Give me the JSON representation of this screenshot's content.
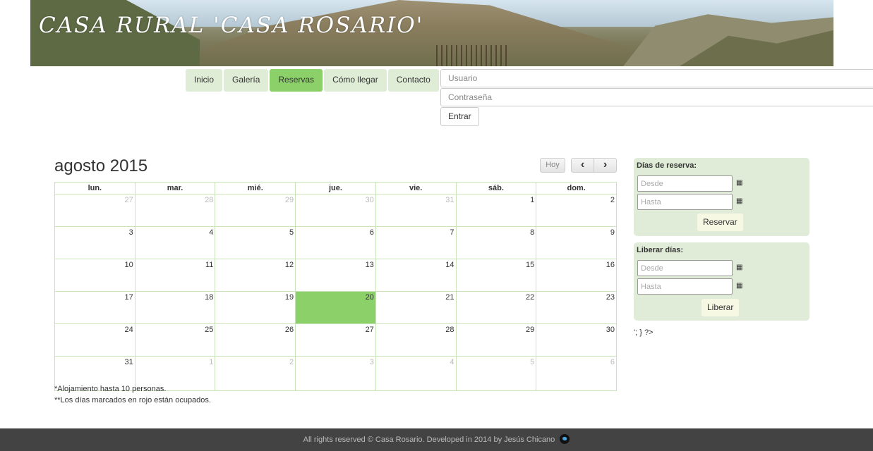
{
  "banner": {
    "title": "CASA RURAL 'CASA ROSARIO'"
  },
  "nav": {
    "tabs": [
      {
        "label": "Inicio"
      },
      {
        "label": "Galería"
      },
      {
        "label": "Reservas"
      },
      {
        "label": "Cómo llegar"
      },
      {
        "label": "Contacto"
      }
    ],
    "active": "Reservas"
  },
  "login": {
    "user_placeholder": "Usuario",
    "password_placeholder": "Contraseña",
    "submit_label": "Entrar"
  },
  "calendar": {
    "title": "agosto 2015",
    "today_label": "Hoy",
    "prev_icon": "chevron-left-icon",
    "next_icon": "chevron-right-icon",
    "prev_glyph": "‹",
    "next_glyph": "›",
    "weekdays": [
      "lun.",
      "mar.",
      "mié.",
      "jue.",
      "vie.",
      "sáb.",
      "dom."
    ],
    "weeks": [
      [
        "27",
        "28",
        "29",
        "30",
        "31",
        "1",
        "2"
      ],
      [
        "3",
        "4",
        "5",
        "6",
        "7",
        "8",
        "9"
      ],
      [
        "10",
        "11",
        "12",
        "13",
        "14",
        "15",
        "16"
      ],
      [
        "17",
        "18",
        "19",
        "20",
        "21",
        "22",
        "23"
      ],
      [
        "24",
        "25",
        "26",
        "27",
        "28",
        "29",
        "30"
      ],
      [
        "31",
        "1",
        "2",
        "3",
        "4",
        "5",
        "6"
      ]
    ],
    "highlighted_day": "20",
    "highlight_color": "#8cd06a"
  },
  "notes": [
    "*Alojamiento hasta 10 personas.",
    "**Los días marcados en rojo están ocupados."
  ],
  "reserve_panel": {
    "title": "Días de reserva:",
    "from_placeholder": "Desde",
    "to_placeholder": "Hasta",
    "button_label": "Reservar"
  },
  "release_panel": {
    "title": "Liberar días:",
    "from_placeholder": "Desde",
    "to_placeholder": "Hasta",
    "button_label": "Liberar"
  },
  "stray_text": "'; } ?>",
  "footer": {
    "text": "All rights reserved © Casa Rosario. Developed in 2014 by Jesús Chicano",
    "icon": "twitter-icon"
  }
}
